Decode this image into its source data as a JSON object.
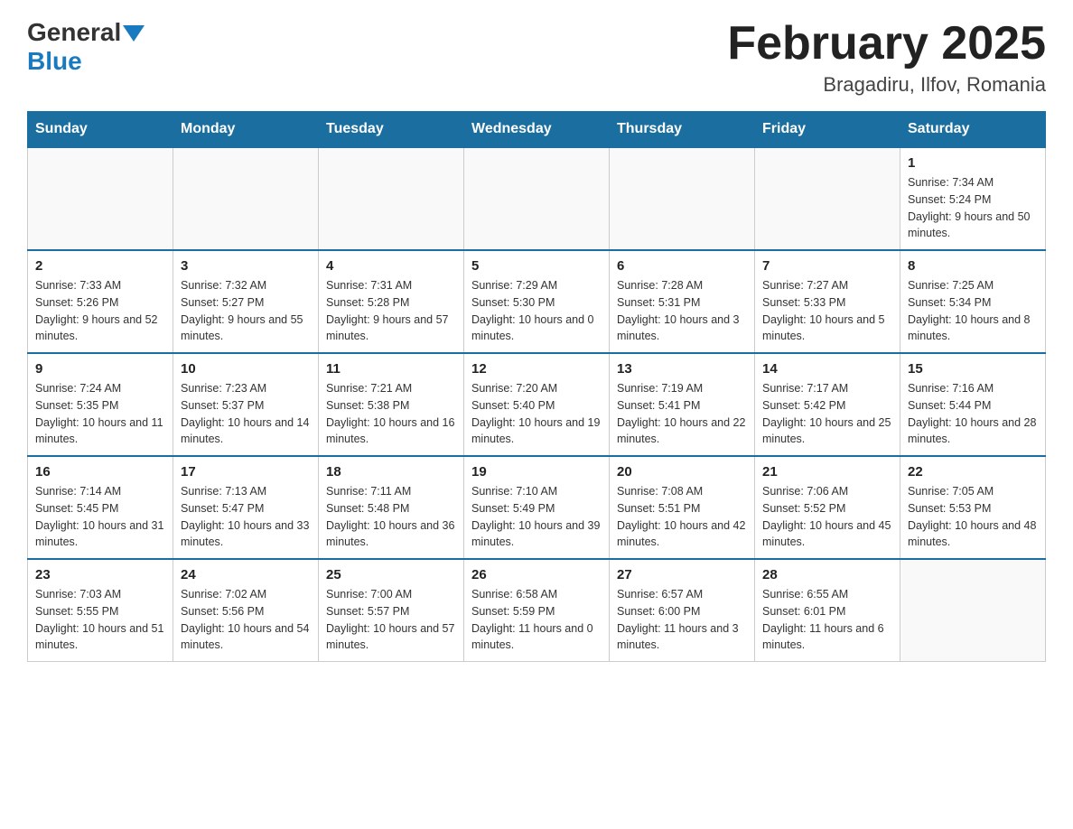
{
  "header": {
    "logo_general": "General",
    "logo_blue": "Blue",
    "month_title": "February 2025",
    "location": "Bragadiru, Ilfov, Romania"
  },
  "days_of_week": [
    "Sunday",
    "Monday",
    "Tuesday",
    "Wednesday",
    "Thursday",
    "Friday",
    "Saturday"
  ],
  "weeks": [
    {
      "days": [
        {
          "num": "",
          "info": ""
        },
        {
          "num": "",
          "info": ""
        },
        {
          "num": "",
          "info": ""
        },
        {
          "num": "",
          "info": ""
        },
        {
          "num": "",
          "info": ""
        },
        {
          "num": "",
          "info": ""
        },
        {
          "num": "1",
          "info": "Sunrise: 7:34 AM\nSunset: 5:24 PM\nDaylight: 9 hours and 50 minutes."
        }
      ]
    },
    {
      "days": [
        {
          "num": "2",
          "info": "Sunrise: 7:33 AM\nSunset: 5:26 PM\nDaylight: 9 hours and 52 minutes."
        },
        {
          "num": "3",
          "info": "Sunrise: 7:32 AM\nSunset: 5:27 PM\nDaylight: 9 hours and 55 minutes."
        },
        {
          "num": "4",
          "info": "Sunrise: 7:31 AM\nSunset: 5:28 PM\nDaylight: 9 hours and 57 minutes."
        },
        {
          "num": "5",
          "info": "Sunrise: 7:29 AM\nSunset: 5:30 PM\nDaylight: 10 hours and 0 minutes."
        },
        {
          "num": "6",
          "info": "Sunrise: 7:28 AM\nSunset: 5:31 PM\nDaylight: 10 hours and 3 minutes."
        },
        {
          "num": "7",
          "info": "Sunrise: 7:27 AM\nSunset: 5:33 PM\nDaylight: 10 hours and 5 minutes."
        },
        {
          "num": "8",
          "info": "Sunrise: 7:25 AM\nSunset: 5:34 PM\nDaylight: 10 hours and 8 minutes."
        }
      ]
    },
    {
      "days": [
        {
          "num": "9",
          "info": "Sunrise: 7:24 AM\nSunset: 5:35 PM\nDaylight: 10 hours and 11 minutes."
        },
        {
          "num": "10",
          "info": "Sunrise: 7:23 AM\nSunset: 5:37 PM\nDaylight: 10 hours and 14 minutes."
        },
        {
          "num": "11",
          "info": "Sunrise: 7:21 AM\nSunset: 5:38 PM\nDaylight: 10 hours and 16 minutes."
        },
        {
          "num": "12",
          "info": "Sunrise: 7:20 AM\nSunset: 5:40 PM\nDaylight: 10 hours and 19 minutes."
        },
        {
          "num": "13",
          "info": "Sunrise: 7:19 AM\nSunset: 5:41 PM\nDaylight: 10 hours and 22 minutes."
        },
        {
          "num": "14",
          "info": "Sunrise: 7:17 AM\nSunset: 5:42 PM\nDaylight: 10 hours and 25 minutes."
        },
        {
          "num": "15",
          "info": "Sunrise: 7:16 AM\nSunset: 5:44 PM\nDaylight: 10 hours and 28 minutes."
        }
      ]
    },
    {
      "days": [
        {
          "num": "16",
          "info": "Sunrise: 7:14 AM\nSunset: 5:45 PM\nDaylight: 10 hours and 31 minutes."
        },
        {
          "num": "17",
          "info": "Sunrise: 7:13 AM\nSunset: 5:47 PM\nDaylight: 10 hours and 33 minutes."
        },
        {
          "num": "18",
          "info": "Sunrise: 7:11 AM\nSunset: 5:48 PM\nDaylight: 10 hours and 36 minutes."
        },
        {
          "num": "19",
          "info": "Sunrise: 7:10 AM\nSunset: 5:49 PM\nDaylight: 10 hours and 39 minutes."
        },
        {
          "num": "20",
          "info": "Sunrise: 7:08 AM\nSunset: 5:51 PM\nDaylight: 10 hours and 42 minutes."
        },
        {
          "num": "21",
          "info": "Sunrise: 7:06 AM\nSunset: 5:52 PM\nDaylight: 10 hours and 45 minutes."
        },
        {
          "num": "22",
          "info": "Sunrise: 7:05 AM\nSunset: 5:53 PM\nDaylight: 10 hours and 48 minutes."
        }
      ]
    },
    {
      "days": [
        {
          "num": "23",
          "info": "Sunrise: 7:03 AM\nSunset: 5:55 PM\nDaylight: 10 hours and 51 minutes."
        },
        {
          "num": "24",
          "info": "Sunrise: 7:02 AM\nSunset: 5:56 PM\nDaylight: 10 hours and 54 minutes."
        },
        {
          "num": "25",
          "info": "Sunrise: 7:00 AM\nSunset: 5:57 PM\nDaylight: 10 hours and 57 minutes."
        },
        {
          "num": "26",
          "info": "Sunrise: 6:58 AM\nSunset: 5:59 PM\nDaylight: 11 hours and 0 minutes."
        },
        {
          "num": "27",
          "info": "Sunrise: 6:57 AM\nSunset: 6:00 PM\nDaylight: 11 hours and 3 minutes."
        },
        {
          "num": "28",
          "info": "Sunrise: 6:55 AM\nSunset: 6:01 PM\nDaylight: 11 hours and 6 minutes."
        },
        {
          "num": "",
          "info": ""
        }
      ]
    }
  ]
}
